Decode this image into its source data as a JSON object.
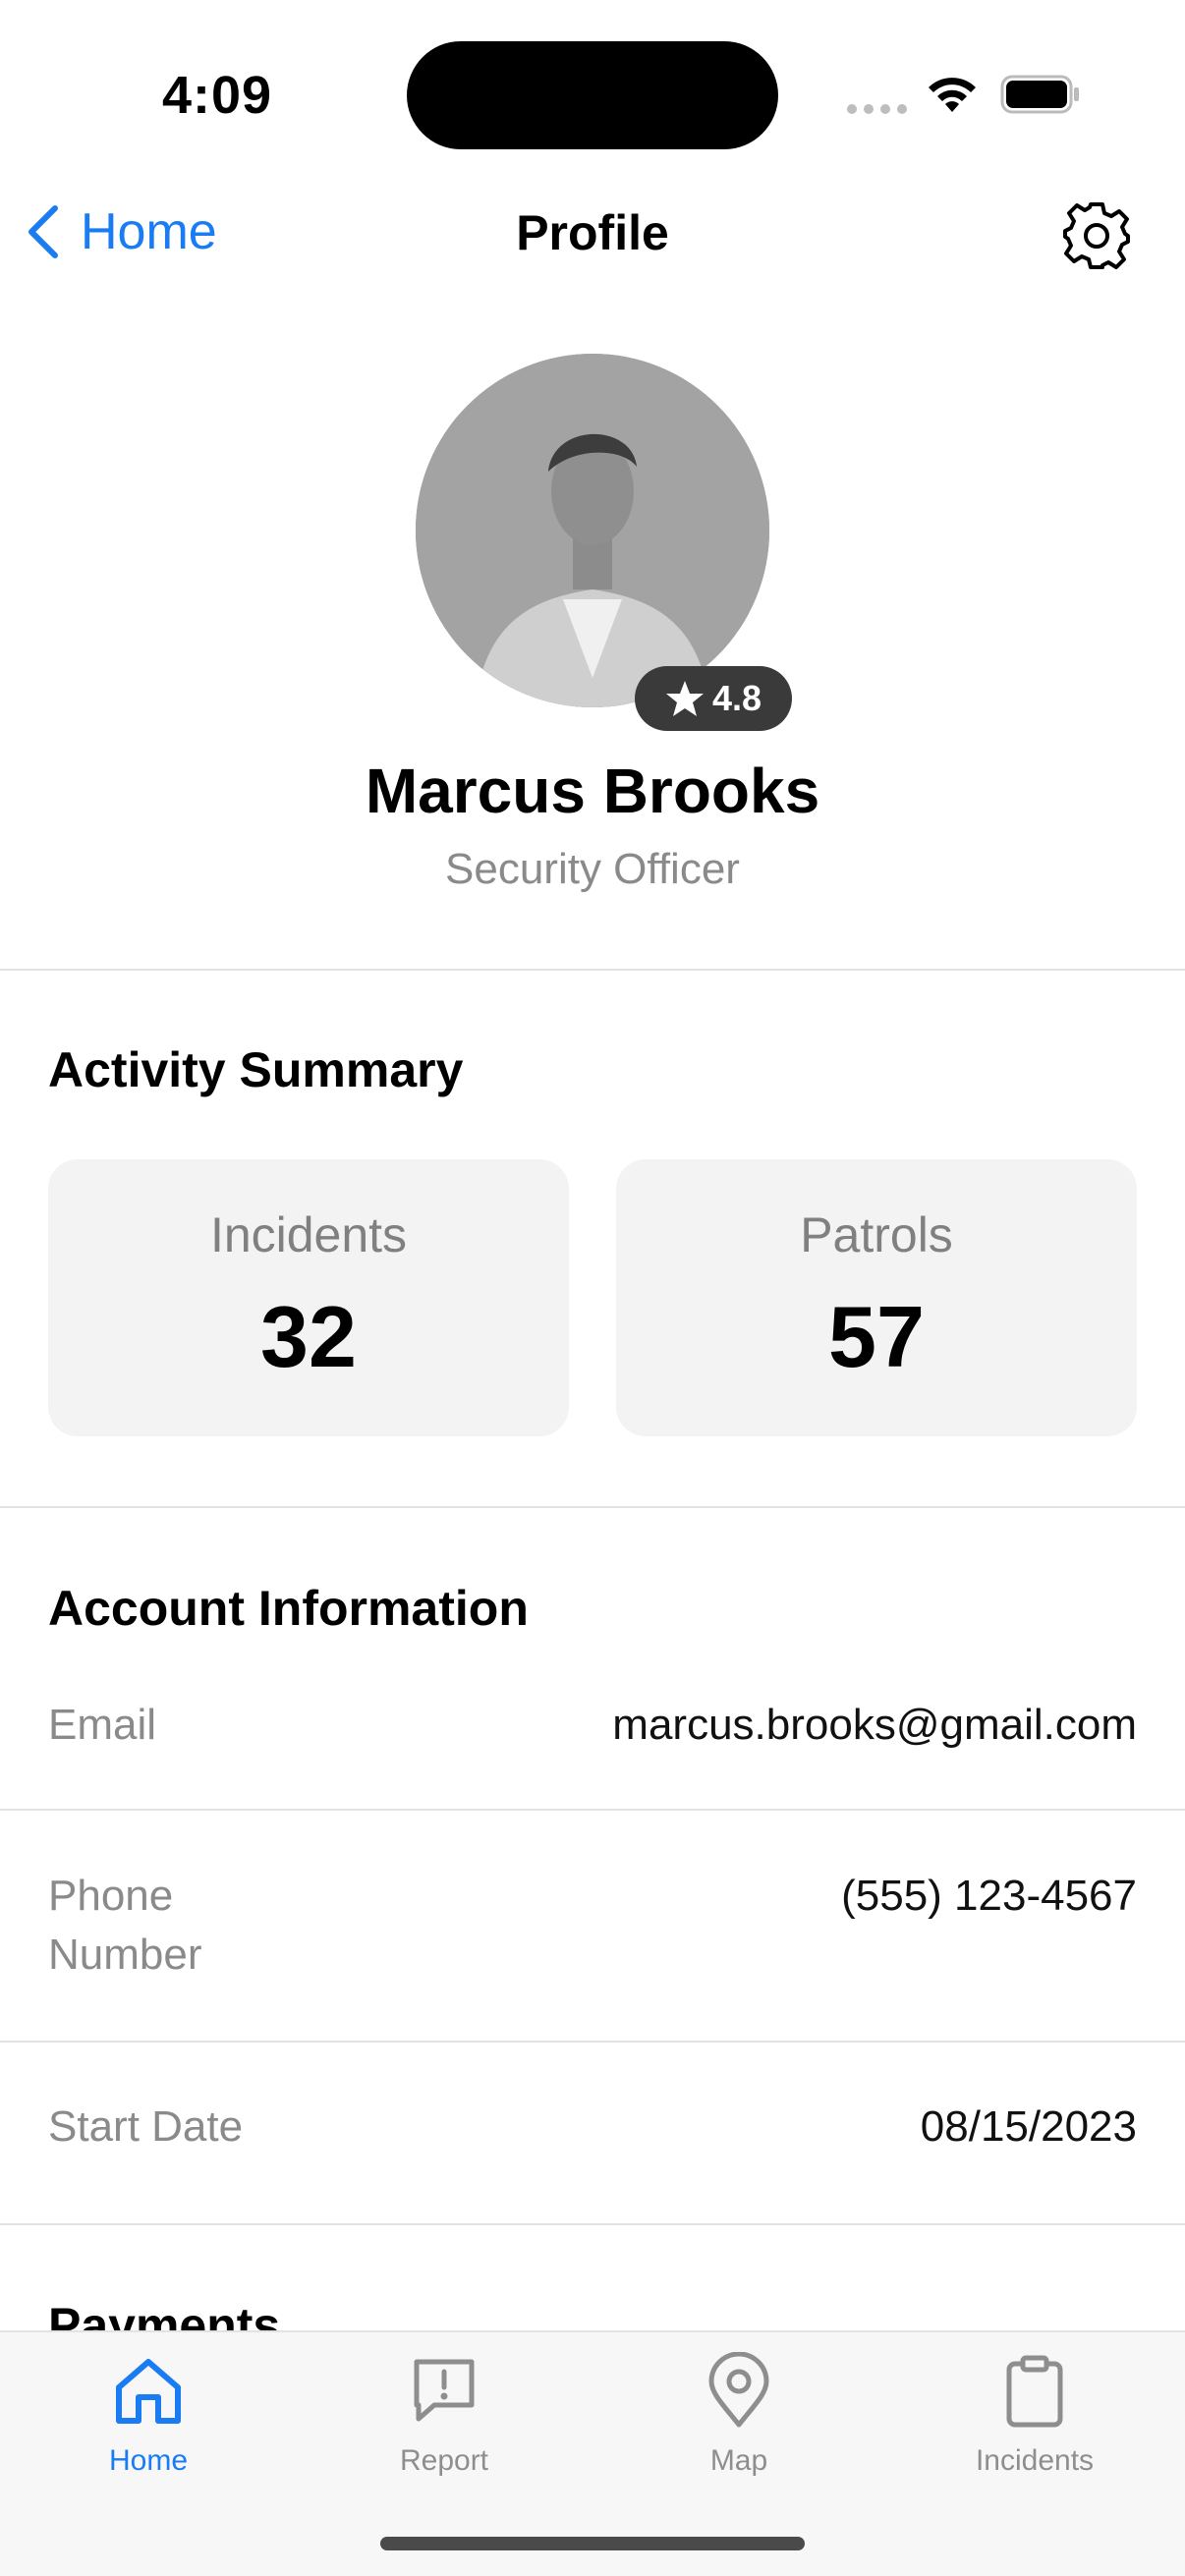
{
  "status_bar": {
    "time": "4:09"
  },
  "nav": {
    "back_label": "Home",
    "title": "Profile"
  },
  "profile": {
    "name": "Marcus Brooks",
    "role": "Security Officer",
    "rating": "4.8"
  },
  "activity": {
    "title": "Activity Summary",
    "cards": [
      {
        "label": "Incidents",
        "value": "32"
      },
      {
        "label": "Patrols",
        "value": "57"
      }
    ]
  },
  "account": {
    "title": "Account Information",
    "rows": [
      {
        "label": "Email",
        "value": "marcus.brooks@gmail.com"
      },
      {
        "label": "Phone Number",
        "value": "(555) 123-4567"
      },
      {
        "label": "Start Date",
        "value": "08/15/2023"
      }
    ]
  },
  "payments": {
    "title": "Payments"
  },
  "tabs": [
    {
      "label": "Home",
      "icon": "house-icon",
      "active": true
    },
    {
      "label": "Report",
      "icon": "report-bubble-icon",
      "active": false
    },
    {
      "label": "Map",
      "icon": "map-pin-icon",
      "active": false
    },
    {
      "label": "Incidents",
      "icon": "clipboard-icon",
      "active": false
    }
  ],
  "colors": {
    "accent": "#1a7cf2",
    "muted": "#8a8a8a",
    "card_bg": "#f3f3f3"
  }
}
